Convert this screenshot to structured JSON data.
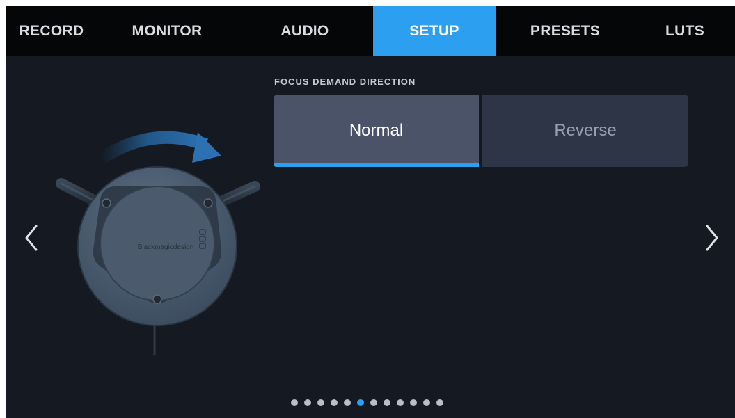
{
  "tabs": [
    {
      "label": "RECORD",
      "active": false
    },
    {
      "label": "MONITOR",
      "active": false
    },
    {
      "label": "AUDIO",
      "active": false
    },
    {
      "label": "SETUP",
      "active": true
    },
    {
      "label": "PRESETS",
      "active": false
    },
    {
      "label": "LUTS",
      "active": false
    }
  ],
  "setting": {
    "title": "FOCUS DEMAND DIRECTION",
    "options": [
      {
        "label": "Normal",
        "selected": true
      },
      {
        "label": "Reverse",
        "selected": false
      }
    ]
  },
  "illustration": {
    "brand": "Blackmagicdesign"
  },
  "pagination": {
    "total": 12,
    "current": 6
  },
  "colors": {
    "accent": "#2c9ff0",
    "background": "#151a22",
    "tabbar": "#050607",
    "selected_option": "#4a5368",
    "unselected_option": "#2d3546"
  },
  "icons": {
    "prev": "chevron-left-icon",
    "next": "chevron-right-icon",
    "rotation": "curved-arrow-icon"
  }
}
